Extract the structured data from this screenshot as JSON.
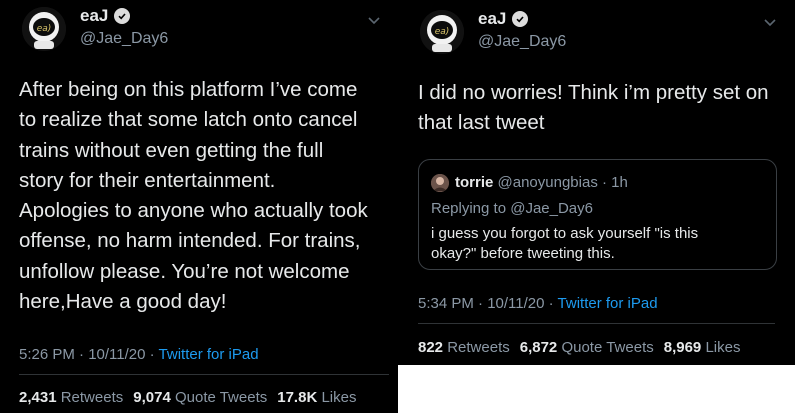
{
  "left_tweet": {
    "author_name": "eaJ",
    "author_handle": "@Jae_Day6",
    "text_lines": [
      "After being on this platform I’ve come",
      "to realize that some latch onto cancel",
      "trains without even getting the full",
      "story for their entertainment.",
      "Apologies to anyone who actually took",
      "offense, no harm intended. For trains,",
      "unfollow please. You’re not welcome",
      "here,Have a good day!"
    ],
    "time": "5:26 PM · 10/11/20 ·",
    "source": "Twitter for iPad",
    "retweets_count": "2,431",
    "retweets_label": "Retweets",
    "quote_count": "9,074",
    "quote_label": "Quote Tweets",
    "likes_count": "17.8K",
    "likes_label": "Likes"
  },
  "right_tweet": {
    "author_name": "eaJ",
    "author_handle": "@Jae_Day6",
    "text_lines": [
      "I did no worries! Think i’m pretty set on",
      "that last tweet"
    ],
    "quoted": {
      "name": "torrie",
      "handle": "@anoyungbias · 1h",
      "replying_prefix": "Replying to",
      "replying_to": "@Jae_Day6",
      "text_lines": [
        "i guess you forgot to ask yourself \"is this",
        "okay?\" before tweeting this."
      ]
    },
    "time": "5:34 PM · 10/11/20 ·",
    "source": "Twitter for iPad",
    "retweets_count": "822",
    "retweets_label": "Retweets",
    "quote_count": "6,872",
    "quote_label": "Quote Tweets",
    "likes_count": "8,969",
    "likes_label": "Likes"
  },
  "icons": {
    "verified": "verified-badge-icon",
    "chevron": "chevron-down-icon",
    "avatar": "astronaut-avatar"
  },
  "colors": {
    "background": "#000000",
    "text": "#e7e9ea",
    "muted": "#8b98a5",
    "link": "#1d9bf0"
  }
}
